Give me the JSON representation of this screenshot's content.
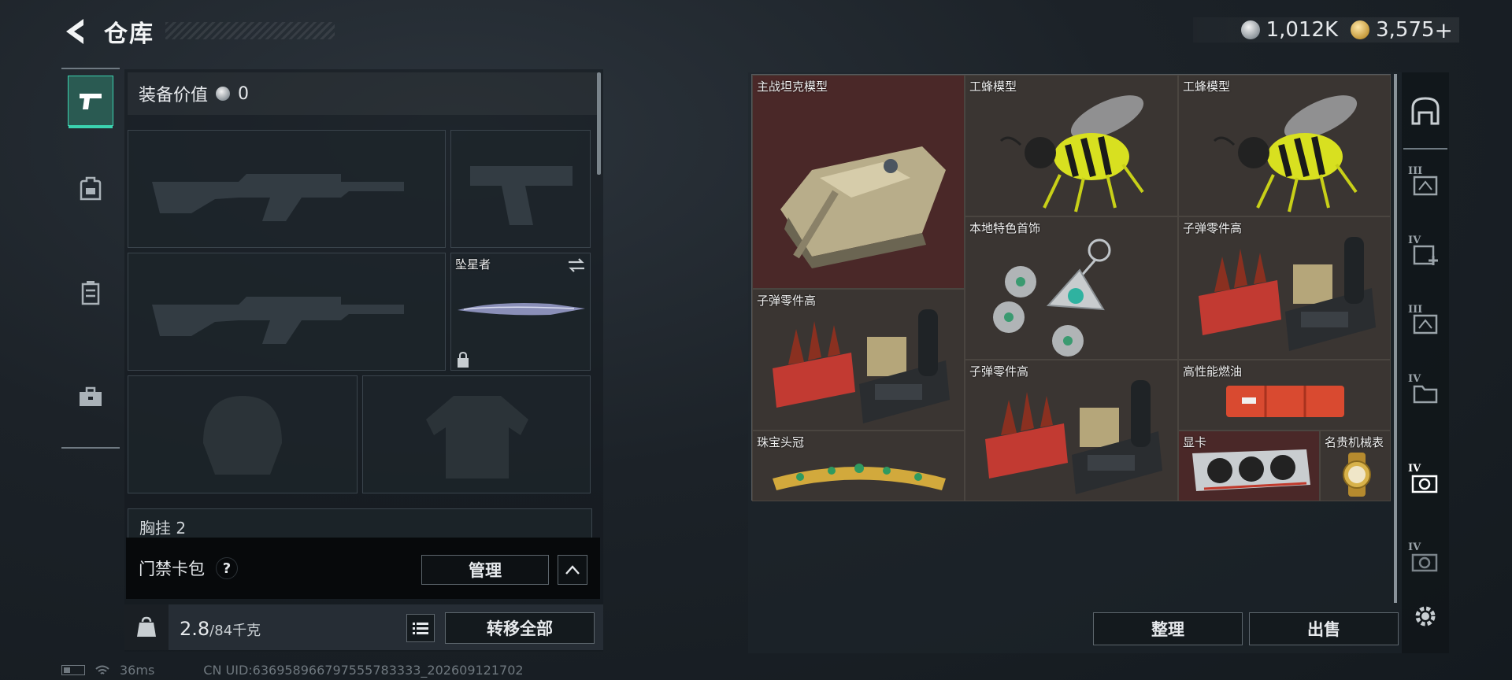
{
  "header": {
    "title": "仓库",
    "currency": {
      "silver": "1,012K",
      "gold": "3,575",
      "gold_plus": "+"
    }
  },
  "left_tabs": [
    {
      "name": "weapons-tab",
      "icon": "pistol-icon",
      "active": true
    },
    {
      "name": "backpack-tab",
      "icon": "backpack-icon",
      "active": false
    },
    {
      "name": "vest-tab",
      "icon": "vest-icon",
      "active": false
    },
    {
      "name": "case-tab",
      "icon": "toolbox-icon",
      "active": false
    }
  ],
  "loadout": {
    "equip_value_label": "装备价值",
    "equip_value": "0",
    "melee_name": "坠星者",
    "chest_label": "胸挂",
    "chest_count": "2",
    "keycard_label": "门禁卡包",
    "keycard_help": "?",
    "manage_label": "管理",
    "weight_current": "2.8",
    "weight_max": "/84千克",
    "transfer_all_label": "转移全部"
  },
  "status": {
    "ping": "36ms",
    "uid": "CN UID:636958966797555783333_202609121702"
  },
  "stash": {
    "items": [
      {
        "name": "主战坦克模型",
        "rarity": "red"
      },
      {
        "name": "工蜂模型",
        "rarity": "normal"
      },
      {
        "name": "工蜂模型",
        "rarity": "normal"
      },
      {
        "name": "本地特色首饰",
        "rarity": "normal"
      },
      {
        "name": "子弹零件高",
        "rarity": "normal"
      },
      {
        "name": "子弹零件高",
        "rarity": "normal"
      },
      {
        "name": "子弹零件高",
        "rarity": "normal"
      },
      {
        "name": "高性能燃油",
        "rarity": "normal"
      },
      {
        "name": "珠宝头冠",
        "rarity": "normal"
      },
      {
        "name": "显卡",
        "rarity": "red"
      },
      {
        "name": "名贵机械表",
        "rarity": "normal"
      }
    ],
    "sort_label": "整理",
    "sell_label": "出售"
  },
  "right_tabs": [
    {
      "name": "stash-home-tab",
      "tier": ""
    },
    {
      "name": "stash-tab-3a",
      "tier": "III"
    },
    {
      "name": "stash-tab-4-add",
      "tier": "IV"
    },
    {
      "name": "stash-tab-3b",
      "tier": "III"
    },
    {
      "name": "stash-tab-4a",
      "tier": "IV"
    },
    {
      "name": "stash-tab-4b",
      "tier": "IV"
    },
    {
      "name": "stash-tab-4c",
      "tier": "IV"
    }
  ]
}
